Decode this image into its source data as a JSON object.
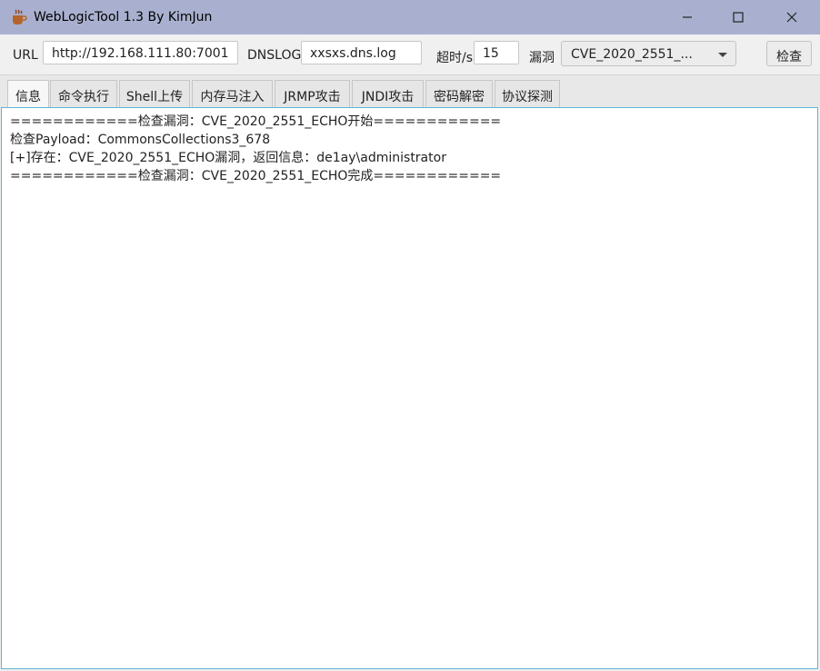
{
  "window": {
    "title": "WebLogicTool 1.3 By KimJun",
    "icon": "coffee-cup-icon"
  },
  "toolbar": {
    "url_label": "URL",
    "url_value": "http://192.168.111.80:7001",
    "dnslog_label": "DNSLOG",
    "dnslog_value": "xxsxs.dns.log",
    "timeout_label": "超时/s",
    "timeout_value": "15",
    "vuln_label": "漏洞",
    "vuln_selected": "CVE_2020_2551_...",
    "check_button": "检查"
  },
  "tabs": [
    {
      "label": "信息",
      "active": true
    },
    {
      "label": "命令执行",
      "active": false
    },
    {
      "label": "Shell上传",
      "active": false
    },
    {
      "label": "内存马注入",
      "active": false
    },
    {
      "label": "JRMP攻击",
      "active": false
    },
    {
      "label": "JNDI攻击",
      "active": false
    },
    {
      "label": "密码解密",
      "active": false
    },
    {
      "label": "协议探测",
      "active": false
    }
  ],
  "console": {
    "lines": [
      "============检查漏洞：CVE_2020_2551_ECHO开始============",
      "检查Payload：CommonsCollections3_678",
      "[+]存在：CVE_2020_2551_ECHO漏洞，返回信息：de1ay\\administrator",
      "============检查漏洞：CVE_2020_2551_ECHO完成============"
    ]
  },
  "colors": {
    "titlebar": "#a9b0cf",
    "content_border": "#5fb4d6"
  }
}
